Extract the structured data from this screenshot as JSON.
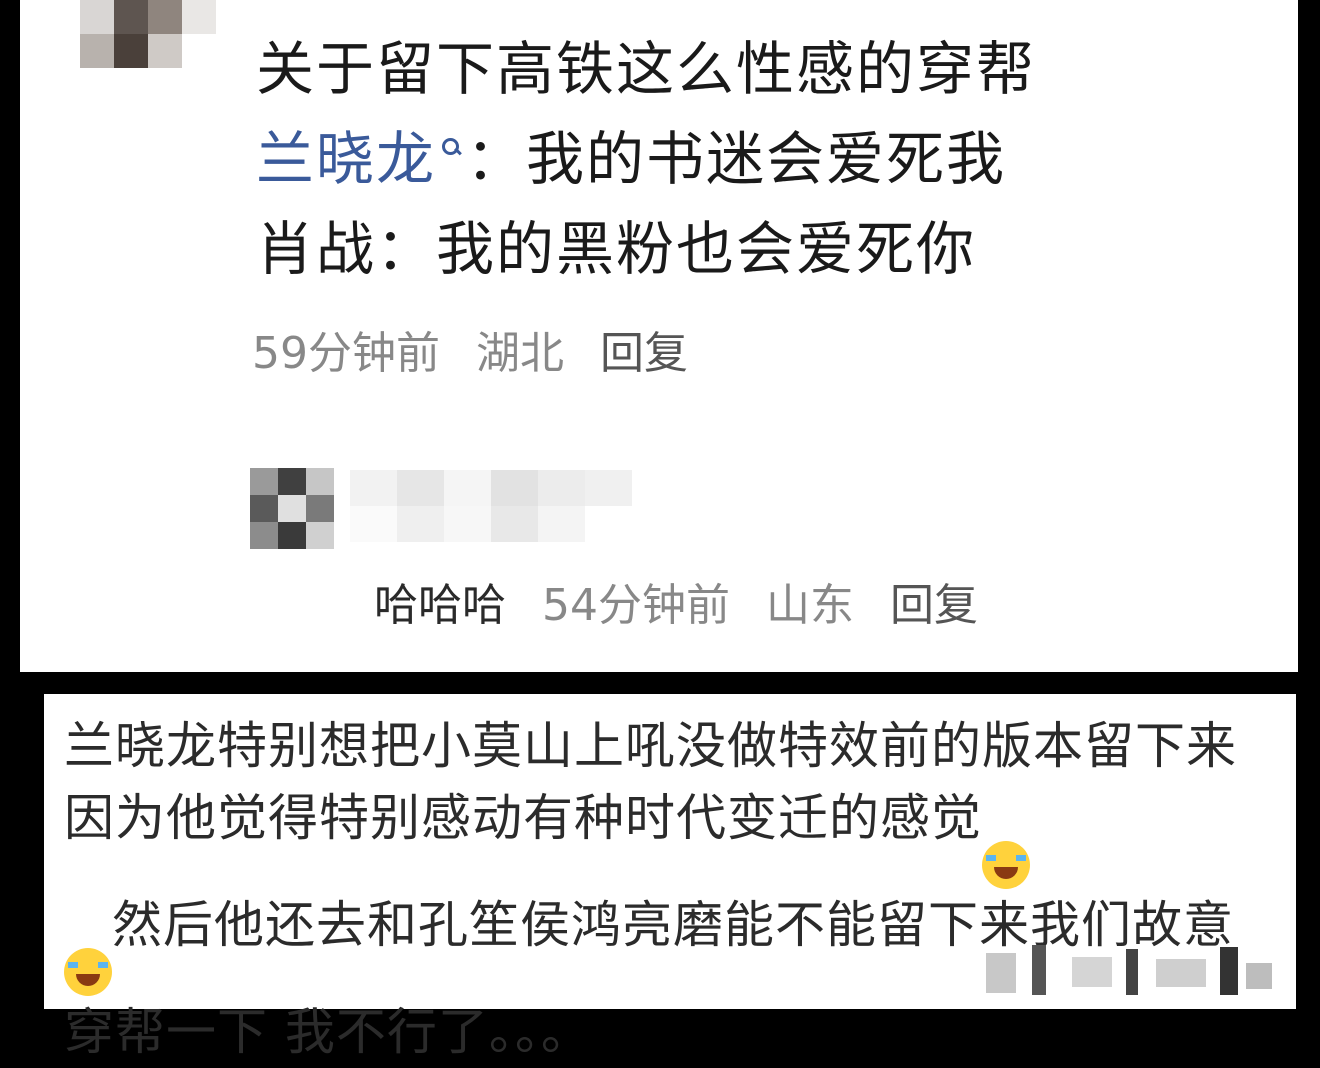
{
  "comment": {
    "line1": "关于留下高铁这么性感的穿帮",
    "author_name": "兰晓龙",
    "line2_rest": "：我的书迷会爱死我",
    "line3": "肖战：我的黑粉也会爱死你",
    "time": "59分钟前",
    "location": "湖北",
    "reply_label": "回复"
  },
  "reply": {
    "text": "哈哈哈",
    "time": "54分钟前",
    "location": "山东",
    "reply_label": "回复"
  },
  "post": {
    "part1": "兰晓龙特别想把小莫山上吼没做特效前的版本留下来 因为他觉得特别感动有种时代变迁的感觉",
    "part2": "然后他还去和孔笙侯鸿亮磨能不能留下来我们故意穿帮一下 我不行了。。。",
    "emoji": "😂"
  },
  "colors": {
    "author_link": "#3a5a9a",
    "meta_text": "#888888",
    "emoji_face": "#ffd23c"
  },
  "icons": [
    "search-icon",
    "laughing-crying-emoji-icon"
  ]
}
